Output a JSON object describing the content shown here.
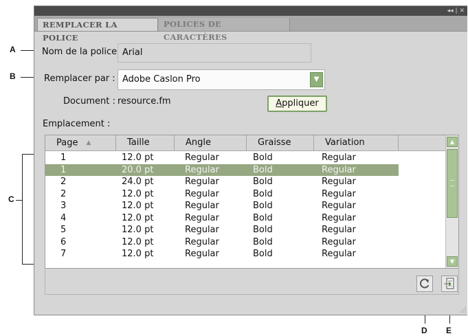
{
  "callouts": {
    "a": "A",
    "b": "B",
    "c": "C",
    "d": "D",
    "e": "E"
  },
  "panel": {
    "tabs": [
      {
        "label": "REMPLACER LA POLICE",
        "active": true
      },
      {
        "label": "POLICES DE CARACTÈRES",
        "active": false
      }
    ],
    "font_name_label": "Nom de la police",
    "font_name_value": "Arial",
    "replace_label": "Remplacer par :",
    "replace_value": "Adobe Caslon Pro",
    "document_label": "Document :",
    "document_value": "resource.fm",
    "apply_button": {
      "pre": "",
      "underlined": "A",
      "post": "ppliquer"
    },
    "location_label": "Emplacement :",
    "columns": [
      "Page",
      "Taille",
      "Angle",
      "Graisse",
      "Variation"
    ],
    "rows": [
      [
        "1",
        "12.0 pt",
        "Regular",
        "Bold",
        "Regular"
      ],
      [
        "1",
        "20.0 pt",
        "Regular",
        "Bold",
        "Regular"
      ],
      [
        "2",
        "24.0 pt",
        "Regular",
        "Bold",
        "Regular"
      ],
      [
        "2",
        "12.0 pt",
        "Regular",
        "Bold",
        "Regular"
      ],
      [
        "3",
        "12.0 pt",
        "Regular",
        "Bold",
        "Regular"
      ],
      [
        "4",
        "12.0 pt",
        "Regular",
        "Bold",
        "Regular"
      ],
      [
        "5",
        "12.0 pt",
        "Regular",
        "Bold",
        "Regular"
      ],
      [
        "6",
        "12.0 pt",
        "Regular",
        "Bold",
        "Regular"
      ],
      [
        "7",
        "12.0 pt",
        "Regular",
        "Bold",
        "Regular"
      ]
    ],
    "selected_row_index": 1,
    "icons": {
      "refresh": "refresh-icon",
      "go_to": "go-to-page-icon"
    }
  },
  "colors": {
    "accent_green": "#96a882",
    "button_green": "#a9c595",
    "panel_bg": "#d6d6d6",
    "titlebar": "#4a4a4a"
  }
}
